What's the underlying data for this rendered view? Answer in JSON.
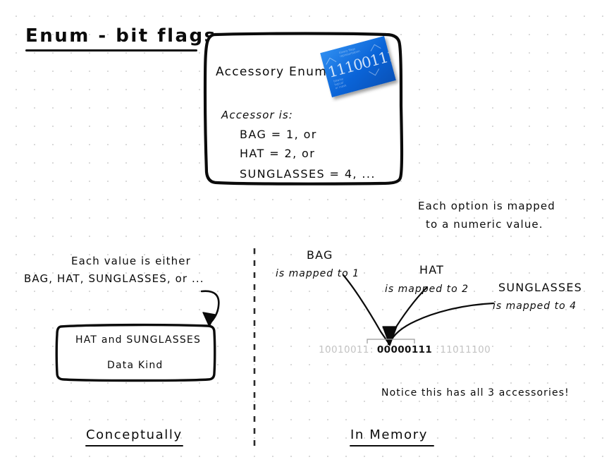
{
  "page": {
    "title": "Enum - bit flags"
  },
  "enum_box": {
    "heading": "Accessory Enum",
    "accessor_label": "Accessor is:",
    "members": [
      "BAG = 1, or",
      "HAT = 2, or",
      "SUNGLASSES = 4, ..."
    ],
    "card": {
      "binary": "11100111",
      "color": "#0a64d8",
      "deco_top": "binary flags\nrepresentation",
      "deco_bottom": "bitwise\nlogical\nor mask"
    }
  },
  "notes": {
    "mapped_line_1": "Each option is mapped",
    "mapped_line_2": "to a numeric value.",
    "conceptual_line_1": "Each value is either",
    "conceptual_line_2": "BAG, HAT, SUNGLASSES, or ...",
    "notice": "Notice this has all 3 accessories!"
  },
  "left_box": {
    "line_1": "HAT and SUNGLASSES",
    "line_2": "Data Kind"
  },
  "mappings": [
    {
      "name": "BAG",
      "text": "is mapped to 1",
      "value": 1
    },
    {
      "name": "HAT",
      "text": "is mapped to 2",
      "value": 2
    },
    {
      "name": "SUNGLASSES",
      "text": "is mapped to 4",
      "value": 4
    }
  ],
  "memory": {
    "previous_byte": "10010011",
    "focused_byte": "00000111",
    "next_byte": "11011100",
    "separator": ":"
  },
  "captions": {
    "left": "Conceptually",
    "right": "In Memory"
  }
}
